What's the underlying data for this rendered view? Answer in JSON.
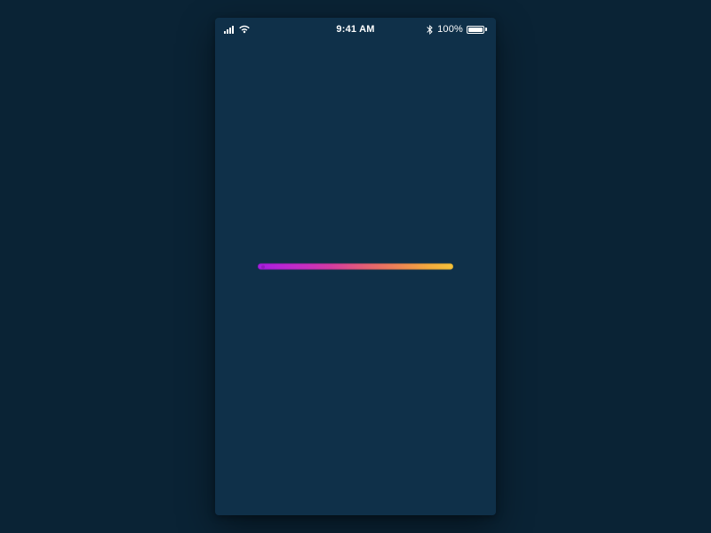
{
  "status_bar": {
    "time": "9:41 AM",
    "battery_percent": "100%",
    "signal_level": 4,
    "wifi": true,
    "bluetooth": true
  },
  "progress": {
    "value_percent": 100,
    "gradient_from": "#a71de1",
    "gradient_to": "#f5c33a"
  },
  "colors": {
    "page_bg": "#0a2335",
    "phone_bg": "#0f3049",
    "status_text": "#ffffff"
  }
}
